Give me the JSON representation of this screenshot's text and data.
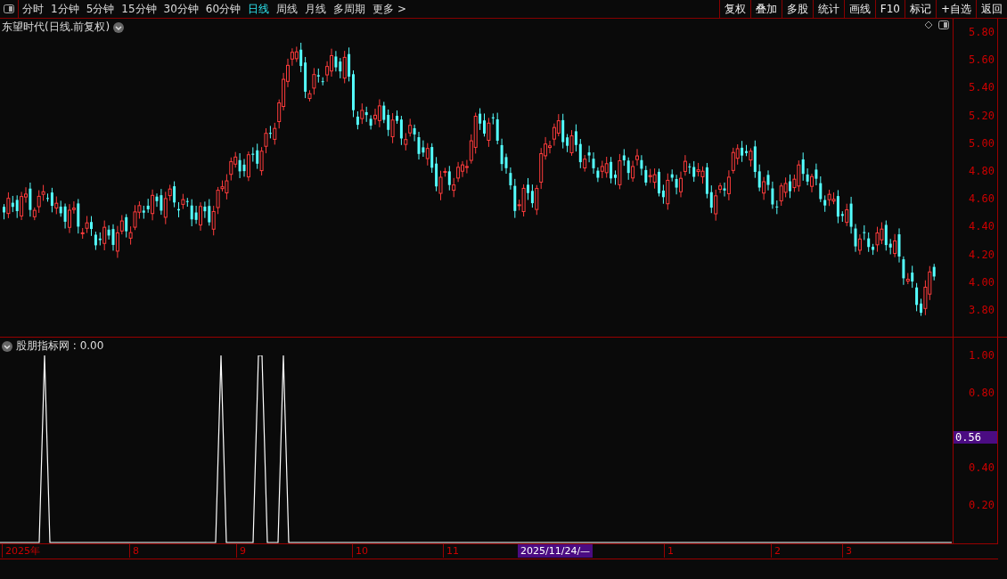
{
  "toolbar": {
    "periods": [
      {
        "label": "分时",
        "selected": false
      },
      {
        "label": "1分钟",
        "selected": false
      },
      {
        "label": "5分钟",
        "selected": false
      },
      {
        "label": "15分钟",
        "selected": false
      },
      {
        "label": "30分钟",
        "selected": false
      },
      {
        "label": "60分钟",
        "selected": false
      },
      {
        "label": "日线",
        "selected": true
      },
      {
        "label": "周线",
        "selected": false
      },
      {
        "label": "月线",
        "selected": false
      },
      {
        "label": "多周期",
        "selected": false
      },
      {
        "label": "更多 >",
        "selected": false
      }
    ],
    "actions": [
      "复权",
      "叠加",
      "多股",
      "统计",
      "画线",
      "F10",
      "标记",
      "+自选",
      "返回"
    ]
  },
  "price_chart": {
    "title": "东望时代(日线.前复权)",
    "yticks": [
      "5.80",
      "5.60",
      "5.40",
      "5.20",
      "5.00",
      "4.80",
      "4.60",
      "4.40",
      "4.20",
      "4.00",
      "3.80"
    ]
  },
  "indicator": {
    "title": "股朋指标网 : 0.00",
    "yticks": [
      "1.00",
      "0.80",
      "0.40",
      "0.20"
    ],
    "cursor_value": "0.56"
  },
  "date_axis": {
    "labels": [
      "2025年",
      "8",
      "9",
      "10",
      "11",
      "1",
      "2",
      "3"
    ],
    "cursor_date": "2025/11/24/—"
  }
}
